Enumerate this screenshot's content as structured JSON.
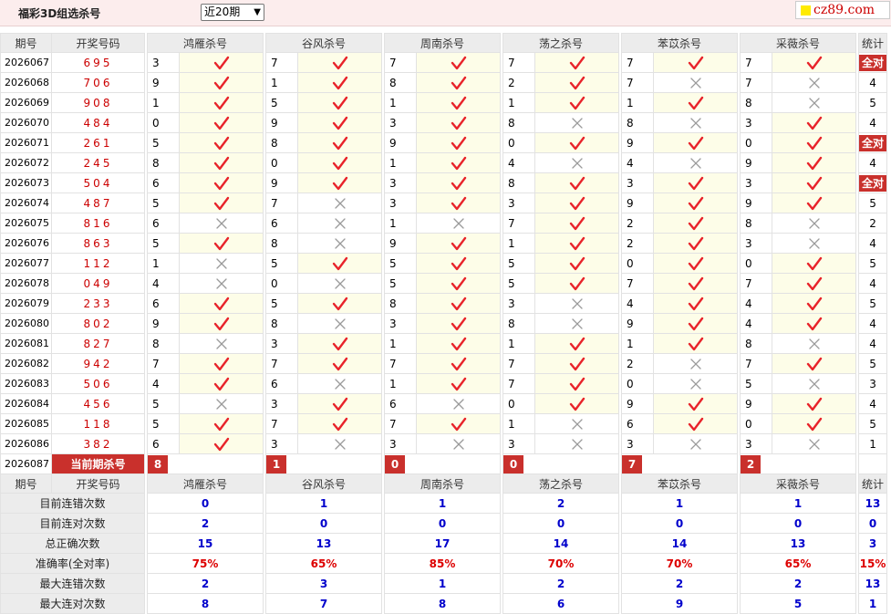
{
  "header": {
    "title": "福彩3D组选杀号",
    "select_value": "近20期",
    "logo_text": "cz89.com"
  },
  "columns": {
    "issue": "期号",
    "draw": "开奖号码",
    "experts": [
      "鸿雁杀号",
      "谷风杀号",
      "周南杀号",
      "荡之杀号",
      "苯苡杀号",
      "采薇杀号"
    ],
    "total": "统计"
  },
  "rows": [
    {
      "issue": "2026067",
      "draw": "695",
      "kills": [
        [
          "3",
          1
        ],
        [
          "7",
          1
        ],
        [
          "7",
          1
        ],
        [
          "7",
          1
        ],
        [
          "7",
          1
        ],
        [
          "7",
          1
        ]
      ],
      "total": "全对"
    },
    {
      "issue": "2026068",
      "draw": "706",
      "kills": [
        [
          "9",
          1
        ],
        [
          "1",
          1
        ],
        [
          "8",
          1
        ],
        [
          "2",
          1
        ],
        [
          "7",
          0
        ],
        [
          "7",
          0
        ]
      ],
      "total": "4"
    },
    {
      "issue": "2026069",
      "draw": "908",
      "kills": [
        [
          "1",
          1
        ],
        [
          "5",
          1
        ],
        [
          "1",
          1
        ],
        [
          "1",
          1
        ],
        [
          "1",
          1
        ],
        [
          "8",
          0
        ]
      ],
      "total": "5"
    },
    {
      "issue": "2026070",
      "draw": "484",
      "kills": [
        [
          "0",
          1
        ],
        [
          "9",
          1
        ],
        [
          "3",
          1
        ],
        [
          "8",
          0
        ],
        [
          "8",
          0
        ],
        [
          "3",
          1
        ]
      ],
      "total": "4"
    },
    {
      "issue": "2026071",
      "draw": "261",
      "kills": [
        [
          "5",
          1
        ],
        [
          "8",
          1
        ],
        [
          "9",
          1
        ],
        [
          "0",
          1
        ],
        [
          "9",
          1
        ],
        [
          "0",
          1
        ]
      ],
      "total": "全对"
    },
    {
      "issue": "2026072",
      "draw": "245",
      "kills": [
        [
          "8",
          1
        ],
        [
          "0",
          1
        ],
        [
          "1",
          1
        ],
        [
          "4",
          0
        ],
        [
          "4",
          0
        ],
        [
          "9",
          1
        ]
      ],
      "total": "4"
    },
    {
      "issue": "2026073",
      "draw": "504",
      "kills": [
        [
          "6",
          1
        ],
        [
          "9",
          1
        ],
        [
          "3",
          1
        ],
        [
          "8",
          1
        ],
        [
          "3",
          1
        ],
        [
          "3",
          1
        ]
      ],
      "total": "全对"
    },
    {
      "issue": "2026074",
      "draw": "487",
      "kills": [
        [
          "5",
          1
        ],
        [
          "7",
          0
        ],
        [
          "3",
          1
        ],
        [
          "3",
          1
        ],
        [
          "9",
          1
        ],
        [
          "9",
          1
        ]
      ],
      "total": "5"
    },
    {
      "issue": "2026075",
      "draw": "816",
      "kills": [
        [
          "6",
          0
        ],
        [
          "6",
          0
        ],
        [
          "1",
          0
        ],
        [
          "7",
          1
        ],
        [
          "2",
          1
        ],
        [
          "8",
          0
        ]
      ],
      "total": "2"
    },
    {
      "issue": "2026076",
      "draw": "863",
      "kills": [
        [
          "5",
          1
        ],
        [
          "8",
          0
        ],
        [
          "9",
          1
        ],
        [
          "1",
          1
        ],
        [
          "2",
          1
        ],
        [
          "3",
          0
        ]
      ],
      "total": "4"
    },
    {
      "issue": "2026077",
      "draw": "112",
      "kills": [
        [
          "1",
          0
        ],
        [
          "5",
          1
        ],
        [
          "5",
          1
        ],
        [
          "5",
          1
        ],
        [
          "0",
          1
        ],
        [
          "0",
          1
        ]
      ],
      "total": "5"
    },
    {
      "issue": "2026078",
      "draw": "049",
      "kills": [
        [
          "4",
          0
        ],
        [
          "0",
          0
        ],
        [
          "5",
          1
        ],
        [
          "5",
          1
        ],
        [
          "7",
          1
        ],
        [
          "7",
          1
        ]
      ],
      "total": "4"
    },
    {
      "issue": "2026079",
      "draw": "233",
      "kills": [
        [
          "6",
          1
        ],
        [
          "5",
          1
        ],
        [
          "8",
          1
        ],
        [
          "3",
          0
        ],
        [
          "4",
          1
        ],
        [
          "4",
          1
        ]
      ],
      "total": "5"
    },
    {
      "issue": "2026080",
      "draw": "802",
      "kills": [
        [
          "9",
          1
        ],
        [
          "8",
          0
        ],
        [
          "3",
          1
        ],
        [
          "8",
          0
        ],
        [
          "9",
          1
        ],
        [
          "4",
          1
        ]
      ],
      "total": "4"
    },
    {
      "issue": "2026081",
      "draw": "827",
      "kills": [
        [
          "8",
          0
        ],
        [
          "3",
          1
        ],
        [
          "1",
          1
        ],
        [
          "1",
          1
        ],
        [
          "1",
          1
        ],
        [
          "8",
          0
        ]
      ],
      "total": "4"
    },
    {
      "issue": "2026082",
      "draw": "942",
      "kills": [
        [
          "7",
          1
        ],
        [
          "7",
          1
        ],
        [
          "7",
          1
        ],
        [
          "7",
          1
        ],
        [
          "2",
          0
        ],
        [
          "7",
          1
        ]
      ],
      "total": "5"
    },
    {
      "issue": "2026083",
      "draw": "506",
      "kills": [
        [
          "4",
          1
        ],
        [
          "6",
          0
        ],
        [
          "1",
          1
        ],
        [
          "7",
          1
        ],
        [
          "0",
          0
        ],
        [
          "5",
          0
        ]
      ],
      "total": "3"
    },
    {
      "issue": "2026084",
      "draw": "456",
      "kills": [
        [
          "5",
          0
        ],
        [
          "3",
          1
        ],
        [
          "6",
          0
        ],
        [
          "0",
          1
        ],
        [
          "9",
          1
        ],
        [
          "9",
          1
        ]
      ],
      "total": "4"
    },
    {
      "issue": "2026085",
      "draw": "118",
      "kills": [
        [
          "5",
          1
        ],
        [
          "7",
          1
        ],
        [
          "7",
          1
        ],
        [
          "1",
          0
        ],
        [
          "6",
          1
        ],
        [
          "0",
          1
        ]
      ],
      "total": "5"
    },
    {
      "issue": "2026086",
      "draw": "382",
      "kills": [
        [
          "6",
          1
        ],
        [
          "3",
          0
        ],
        [
          "3",
          0
        ],
        [
          "3",
          0
        ],
        [
          "3",
          0
        ],
        [
          "3",
          0
        ]
      ],
      "total": "1"
    }
  ],
  "current": {
    "issue": "2026087",
    "label": "当前期杀号",
    "kills": [
      "8",
      "1",
      "0",
      "0",
      "7",
      "2"
    ]
  },
  "stats": [
    {
      "label": "目前连错次数",
      "values": [
        "0",
        "1",
        "1",
        "2",
        "1",
        "1"
      ],
      "total": "13",
      "red": false
    },
    {
      "label": "目前连对次数",
      "values": [
        "2",
        "0",
        "0",
        "0",
        "0",
        "0"
      ],
      "total": "0",
      "red": false
    },
    {
      "label": "总正确次数",
      "values": [
        "15",
        "13",
        "17",
        "14",
        "14",
        "13"
      ],
      "total": "3",
      "red": false
    },
    {
      "label": "准确率(全对率)",
      "values": [
        "75%",
        "65%",
        "85%",
        "70%",
        "70%",
        "65%"
      ],
      "total": "15%",
      "red": true
    },
    {
      "label": "最大连错次数",
      "values": [
        "2",
        "3",
        "1",
        "2",
        "2",
        "2"
      ],
      "total": "13",
      "red": false
    },
    {
      "label": "最大连对次数",
      "values": [
        "8",
        "7",
        "8",
        "6",
        "9",
        "5"
      ],
      "total": "1",
      "red": false
    }
  ],
  "icons": {
    "correct": "check-icon",
    "wrong": "cross-icon"
  },
  "colors": {
    "check": "#e8232a",
    "cross": "#9a9a9a",
    "red_badge": "#c9302c",
    "blue_value": "#0000cc",
    "draw_red": "#cc0000",
    "row_hl": "#fdfde8"
  }
}
